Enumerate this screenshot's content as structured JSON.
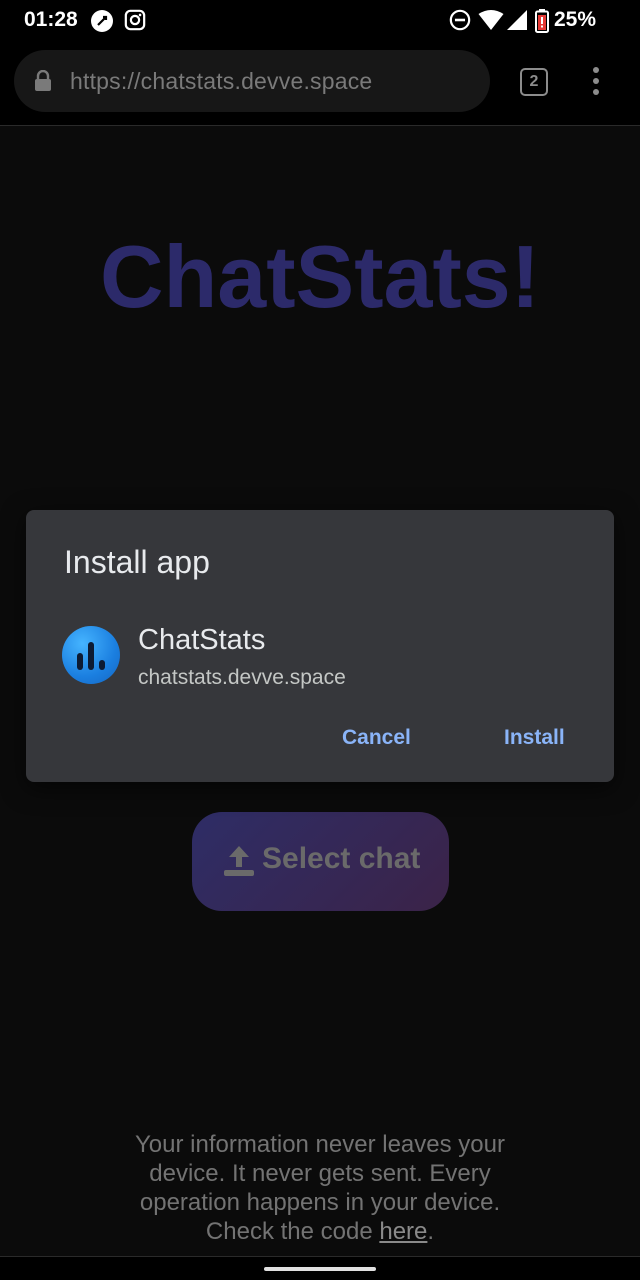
{
  "status_bar": {
    "time": "01:28",
    "battery_percent": "25%",
    "icons": [
      "app-notification-icon",
      "instagram-icon",
      "do-not-disturb-icon",
      "wifi-icon",
      "signal-icon",
      "battery-low-icon"
    ]
  },
  "browser": {
    "url": "https://chatstats.devve.space",
    "tab_count": "2",
    "icons": [
      "lock-icon",
      "overflow-menu-icon"
    ]
  },
  "page": {
    "title": "ChatStats!",
    "subtitle_partial": "",
    "select_button_label": "Select chat",
    "footer_text": "Your information never leaves your device. It never gets sent. Every operation happens in your device. Check the code ",
    "footer_link": "here",
    "footer_end": "."
  },
  "dialog": {
    "title": "Install app",
    "app_name": "ChatStats",
    "app_url": "chatstats.devve.space",
    "cancel_label": "Cancel",
    "install_label": "Install"
  },
  "colors": {
    "accent": "#8ab4f8",
    "dialog_bg": "#36373b",
    "title_color": "#2c2a6a",
    "app_icon": "#1b7fe0"
  }
}
